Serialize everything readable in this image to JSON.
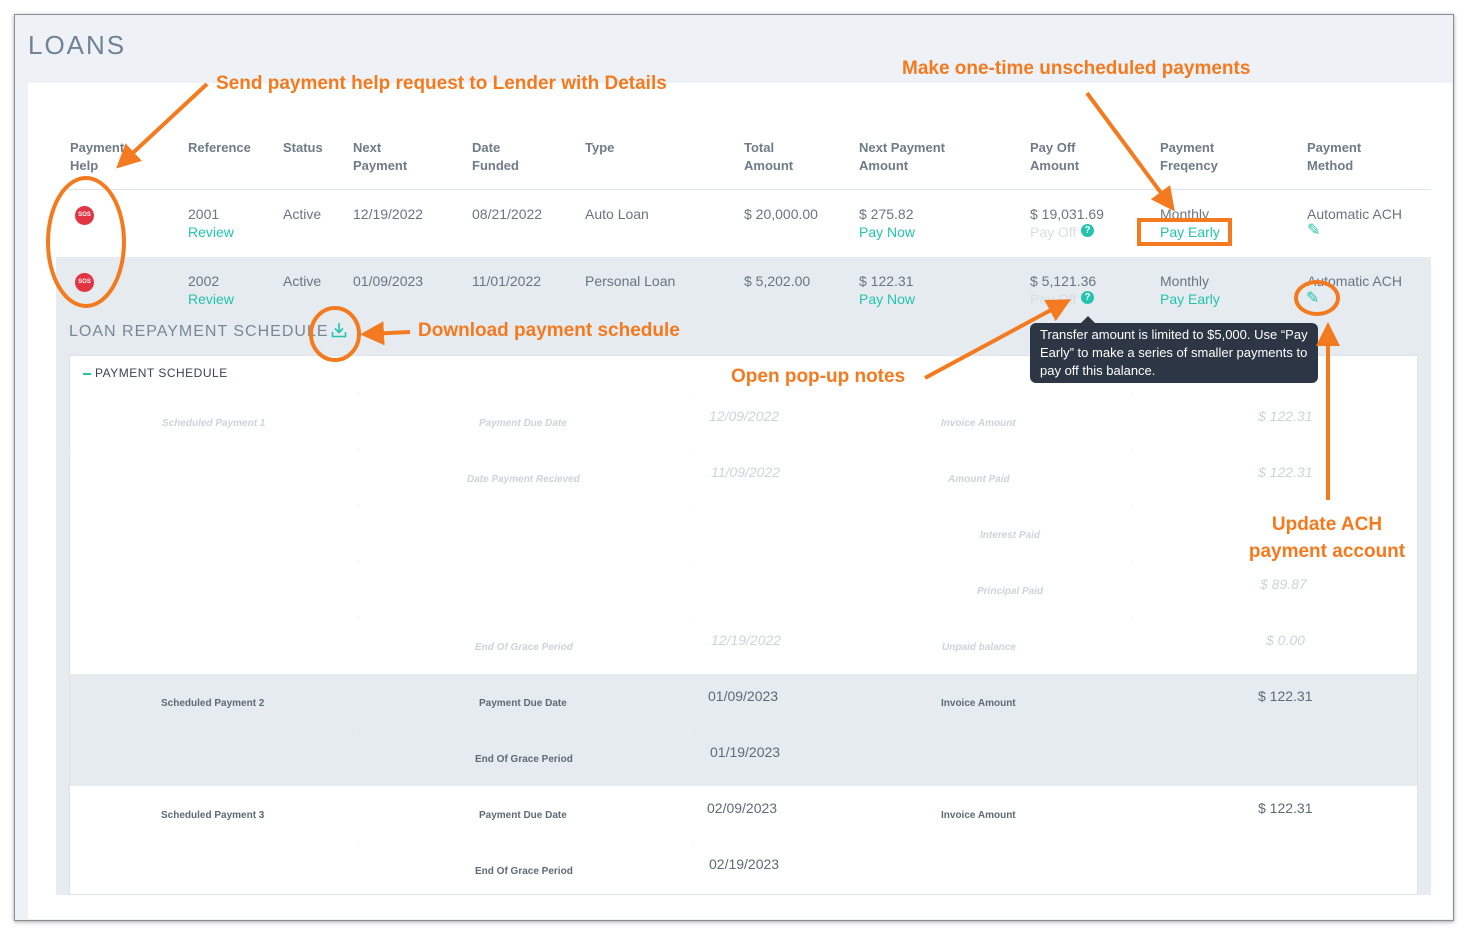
{
  "page": {
    "title": "LOANS"
  },
  "table": {
    "headers": [
      {
        "line1": "Payment",
        "line2": "Help"
      },
      {
        "line1": "Reference",
        "line2": ""
      },
      {
        "line1": "Status",
        "line2": ""
      },
      {
        "line1": "Next",
        "line2": "Payment"
      },
      {
        "line1": "Date",
        "line2": "Funded"
      },
      {
        "line1": "Type",
        "line2": ""
      },
      {
        "line1": "Total",
        "line2": "Amount"
      },
      {
        "line1": "Next Payment",
        "line2": "Amount"
      },
      {
        "line1": "Pay Off",
        "line2": "Amount"
      },
      {
        "line1": "Payment",
        "line2": "Freqency"
      },
      {
        "line1": "Payment",
        "line2": "Method"
      }
    ],
    "rows": [
      {
        "sos": "SOS",
        "reference": "2001",
        "review": "Review",
        "status": "Active",
        "next_payment": "12/19/2022",
        "date_funded": "08/21/2022",
        "type": "Auto Loan",
        "total_amount": "$ 20,000.00",
        "next_payment_amount": "$ 275.82",
        "pay_now": "Pay Now",
        "payoff_amount": "$ 19,031.69",
        "pay_off_link": "Pay Off",
        "frequency": "Monthly",
        "pay_early": "Pay Early",
        "method": "Automatic ACH"
      },
      {
        "sos": "SOS",
        "reference": "2002",
        "review": "Review",
        "status": "Active",
        "next_payment": "01/09/2023",
        "date_funded": "11/01/2022",
        "type": "Personal Loan",
        "total_amount": "$ 5,202.00",
        "next_payment_amount": "$ 122.31",
        "pay_now": "Pay Now",
        "payoff_amount": "$ 5,121.36",
        "pay_off_link": "Pay Off",
        "frequency": "Monthly",
        "pay_early": "Pay Early",
        "method": "Automatic ACH"
      }
    ]
  },
  "tooltip": {
    "text": "Transfer amount is limited to $5,000. Use “Pay Early” to make a series of smaller payments to pay off this balance."
  },
  "schedule": {
    "title": "LOAN REPAYMENT SCHEDULE",
    "header": "PAYMENT SCHEDULE",
    "payment1": {
      "name": "Scheduled Payment 1",
      "due_label": "Payment Due Date",
      "due_value": "12/09/2022",
      "invoice_label": "Invoice Amount",
      "invoice_value": "$ 122.31",
      "received_label": "Date Payment Recieved",
      "received_value": "11/09/2022",
      "paid_label": "Amount Paid",
      "paid_value": "$ 122.31",
      "interest_label": "Interest Paid",
      "principal_label": "Principal Paid",
      "principal_value": "$ 89.87",
      "grace_label": "End Of Grace Period",
      "grace_value": "12/19/2022",
      "unpaid_label": "Unpaid balance",
      "unpaid_value": "$ 0.00"
    },
    "payment2": {
      "name": "Scheduled Payment 2",
      "due_label": "Payment Due Date",
      "due_value": "01/09/2023",
      "invoice_label": "Invoice Amount",
      "invoice_value": "$ 122.31",
      "grace_label": "End Of Grace Period",
      "grace_value": "01/19/2023"
    },
    "payment3": {
      "name": "Scheduled Payment 3",
      "due_label": "Payment Due Date",
      "due_value": "02/09/2023",
      "invoice_label": "Invoice Amount",
      "invoice_value": "$ 122.31",
      "grace_label": "End Of Grace Period",
      "grace_value": "02/19/2023"
    }
  },
  "annotations": {
    "help": "Send payment help request to Lender with Details",
    "unscheduled": "Make one-time unscheduled payments",
    "download": "Download payment schedule",
    "notes": "Open pop-up notes",
    "ach_line1": "Update ACH",
    "ach_line2": "payment account"
  },
  "colors": {
    "accent": "#22c4ad",
    "sos": "#e23442",
    "annotation": "#f47a1f",
    "tooltip_bg": "#2c3644"
  },
  "icons": [
    "sos-icon",
    "question-icon",
    "pencil-icon",
    "download-icon"
  ]
}
